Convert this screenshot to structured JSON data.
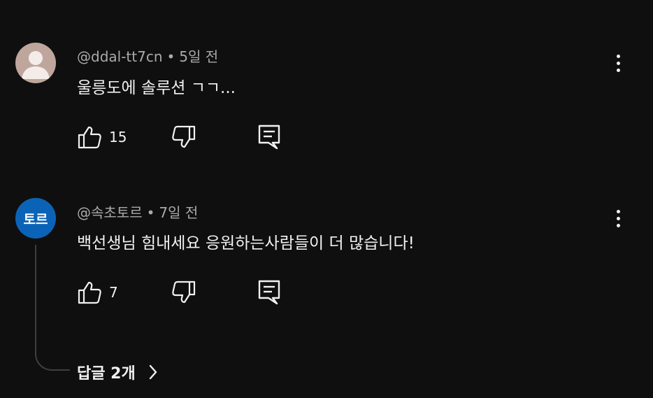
{
  "comments": [
    {
      "author": "@ddal-tt7cn",
      "time": "5일 전",
      "separator": "•",
      "text": "울릉도에 솔루션 ㄱㄱ...",
      "likes": "15",
      "avatar": "default-person"
    },
    {
      "author": "@속초토르",
      "time": "7일 전",
      "separator": "•",
      "text": "백선생님 힘내세요 응원하는사람들이 더 많습니다!",
      "likes": "7",
      "avatar_text": "토르",
      "avatar_color": "#0b63b7"
    }
  ],
  "replies": {
    "label": "답글 2개"
  },
  "icons": {
    "like": "thumbs-up-icon",
    "dislike": "thumbs-down-icon",
    "reply": "comment-icon",
    "more": "more-vertical-icon",
    "expand": "chevron-right-icon"
  },
  "colors": {
    "background": "#0f0f0f",
    "text": "#f1f1f1",
    "meta": "#aaaaaa",
    "avatar_default_bg": "#bfa69c"
  }
}
